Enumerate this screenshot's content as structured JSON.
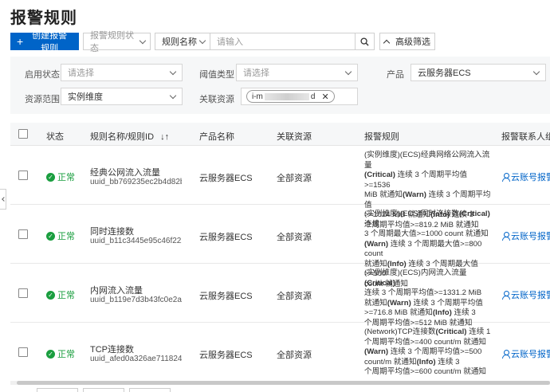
{
  "page": {
    "title": "报警规则"
  },
  "toolbar": {
    "create_label": "创建报警规则",
    "status_filter_placeholder": "报警规则状态",
    "search_key": "规则名称",
    "search_placeholder": "请输入",
    "advanced_label": "高级筛选"
  },
  "filters": {
    "enable_status": {
      "label": "启用状态",
      "placeholder": "请选择"
    },
    "threshold_type": {
      "label": "阈值类型",
      "placeholder": "请选择"
    },
    "product": {
      "label": "产品",
      "value": "云服务器ECS"
    },
    "resource_scope": {
      "label": "资源范围",
      "value": "实例维度"
    },
    "related_resource": {
      "label": "关联资源",
      "tag_prefix": "i-m",
      "tag_suffix": "d"
    }
  },
  "table": {
    "headers": {
      "status": "状态",
      "rule_name": "规则名称/规则ID",
      "product": "产品名称",
      "resource": "关联资源",
      "alarm_rule": "报警规则",
      "contact": "报警联系人组"
    },
    "rows": [
      {
        "status": "正常",
        "name": "经典公网流入流量",
        "id": "uuid_bb769235ec2b4d82b3...",
        "product": "云服务器ECS",
        "resource": "全部资源",
        "rule_lines": [
          [
            {
              "t": "(实例维度)(ECS)经典网络公网流入流量"
            }
          ],
          [
            {
              "t": "(Critical)",
              "b": true
            },
            {
              "t": " 连续 3 个周期平均值>=1536"
            }
          ],
          [
            {
              "t": "MiB 就通知"
            },
            {
              "t": "(Warn)",
              "b": true
            },
            {
              "t": " 连续 3 个周期平均值"
            }
          ],
          [
            {
              "t": ">=1024 MiB 就通知"
            },
            {
              "t": "(Info)",
              "b": true
            },
            {
              "t": " 连续 3"
            }
          ],
          [
            {
              "t": "个周期平均值>=819.2 MiB 就通知"
            }
          ]
        ],
        "contact": "云账号报警联"
      },
      {
        "status": "正常",
        "name": "同时连接数",
        "id": "uuid_b11c3445e95c46f2220...",
        "product": "云服务器ECS",
        "resource": "全部资源",
        "rule_lines": [
          [
            {
              "t": "(实例维度)(ECS)同时连接数"
            },
            {
              "t": "(Critical)",
              "b": true
            },
            {
              "t": " 连续"
            }
          ],
          [
            {
              "t": "3 个周期最大值>=1000 count 就通知"
            }
          ],
          [
            {
              "t": "(Warn)",
              "b": true
            },
            {
              "t": " 连续 3 个周期最大值>=800 count"
            }
          ],
          [
            {
              "t": "就通知"
            },
            {
              "t": "(Info)",
              "b": true
            },
            {
              "t": " 连续 3 个周期最大值>=500"
            }
          ],
          [
            {
              "t": "count 就通知"
            }
          ]
        ],
        "contact": "云账号报警联"
      },
      {
        "status": "正常",
        "name": "内网流入流量",
        "id": "uuid_b119e7d3b43fc0e2a44...",
        "product": "云服务器ECS",
        "resource": "全部资源",
        "rule_lines": [
          [
            {
              "t": "(实例维度)(ECS)内网流入流量"
            },
            {
              "t": "(Critical)",
              "b": true
            }
          ],
          [
            {
              "t": "连续 3 个周期平均值>=1331.2 MiB"
            }
          ],
          [
            {
              "t": "就通知"
            },
            {
              "t": "(Warn)",
              "b": true
            },
            {
              "t": " 连续 3 个周期平均值"
            }
          ],
          [
            {
              "t": ">=716.8 MiB 就通知"
            },
            {
              "t": "(Info)",
              "b": true
            },
            {
              "t": " 连续 3"
            }
          ],
          [
            {
              "t": "个周期平均值>=512 MiB 就通知"
            }
          ]
        ],
        "contact": "云账号报警联"
      },
      {
        "status": "正常",
        "name": "TCP连接数",
        "id": "uuid_afed0a326ae711824f3...",
        "product": "云服务器ECS",
        "resource": "全部资源",
        "rule_lines": [
          [
            {
              "t": "(Network)TCP连接数"
            },
            {
              "t": "(Critical)",
              "b": true
            },
            {
              "t": " 连续 1"
            }
          ],
          [
            {
              "t": "个周期平均值>=400 count/m 就通知"
            }
          ],
          [
            {
              "t": "(Warn)",
              "b": true
            },
            {
              "t": " 连续 3 个周期平均值>=500"
            }
          ],
          [
            {
              "t": "count/m 就通知"
            },
            {
              "t": "(Info)",
              "b": true
            },
            {
              "t": " 连续 3"
            }
          ],
          [
            {
              "t": "个周期平均值>=600 count/m 就通知"
            }
          ]
        ],
        "contact": "云账号报警联"
      }
    ]
  }
}
